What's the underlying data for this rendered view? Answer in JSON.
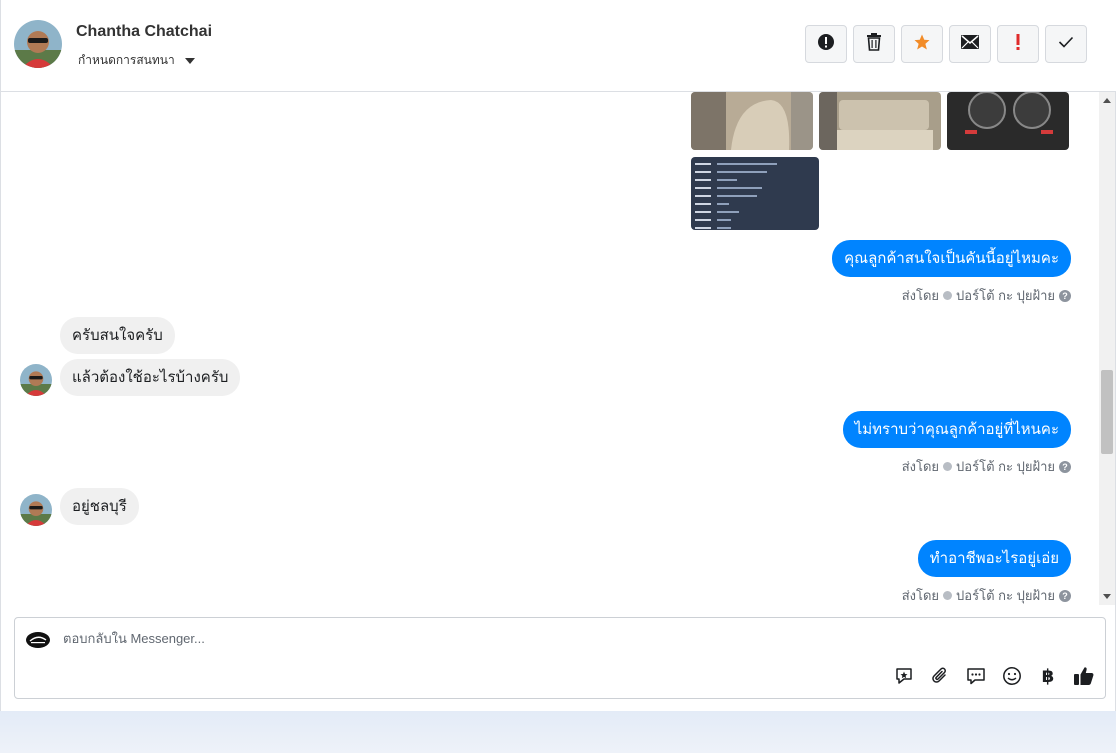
{
  "header": {
    "contact_name": "Chantha Chatchai",
    "conversation_setting": "กำหนดการสนทนา",
    "toolbar": [
      {
        "name": "spam-button",
        "icon": "alert-circle-icon"
      },
      {
        "name": "delete-button",
        "icon": "trash-icon"
      },
      {
        "name": "star-button",
        "icon": "star-icon",
        "color": "#f28c28"
      },
      {
        "name": "mark-unread-button",
        "icon": "envelope-icon"
      },
      {
        "name": "flag-important-button",
        "icon": "exclamation-icon",
        "color": "#e02b2b"
      },
      {
        "name": "mark-done-button",
        "icon": "check-icon"
      }
    ]
  },
  "messages": {
    "out1": "คุณลูกค้าสนใจเป็นคันนี้อยู่ไหมคะ",
    "in1": "ครับสนใจครับ",
    "in2": "แล้วต้องใช้อะไรบ้างครับ",
    "out2": "ไม่ทราบว่าคุณลูกค้าอยู่ที่ไหนคะ",
    "in3": "อยู่ชลบุรี",
    "out3": "ทำอาชีพอะไรอยู่เอ่ย"
  },
  "sent_by": {
    "prefix": "ส่งโดย",
    "agent": "ปอร์โต้ กะ ปุยฝ้าย",
    "help": "?"
  },
  "composer": {
    "placeholder": "ตอบกลับใน Messenger...",
    "tools": [
      "saved-reply-icon",
      "attachment-icon",
      "chat-bubble-icon",
      "emoji-icon",
      "baht-icon",
      "thumbs-up-icon"
    ],
    "baht_symbol": "฿"
  },
  "colors": {
    "accent": "#0084ff",
    "star": "#f28c28",
    "important": "#e02b2b"
  }
}
